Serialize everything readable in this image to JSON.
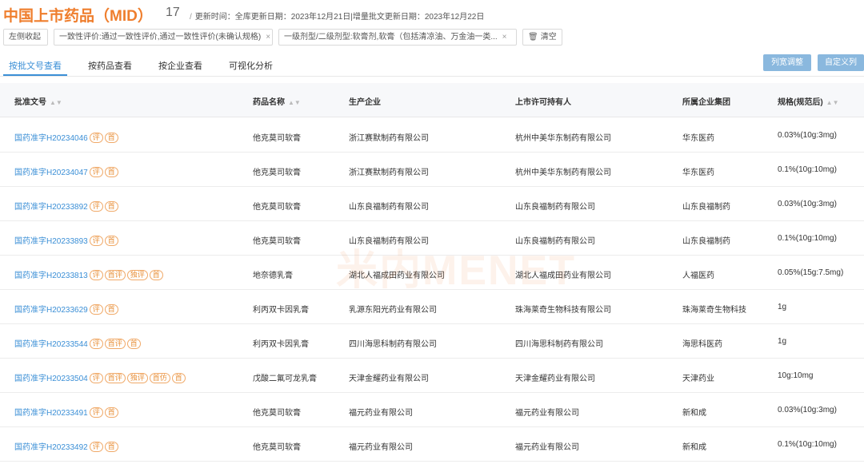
{
  "header": {
    "title": "中国上市药品（MID）",
    "count": "17",
    "update_sep": "/",
    "update_text": "更新时间：全库更新日期：2023年12月21日|增量批文更新日期：2023年12月22日"
  },
  "filters": {
    "collapse_label": "左侧收起",
    "chip1": "一致性评价:通过一致性评价,通过一致性评价(未确认规格)",
    "chip2": "一级剂型/二级剂型:软膏剂,软膏（包括清凉油、万金油一类...",
    "close_glyph": "×",
    "trash_glyph": "🗑",
    "clear_label": "清空"
  },
  "tabs": [
    {
      "label": "按批文号查看",
      "active": true
    },
    {
      "label": "按药品查看",
      "active": false
    },
    {
      "label": "按企业查看",
      "active": false
    },
    {
      "label": "可视化分析",
      "active": false
    }
  ],
  "buttons": {
    "adjust_width": "列宽调整",
    "custom_columns": "自定义列"
  },
  "table": {
    "columns": [
      "批准文号",
      "药品名称",
      "生产企业",
      "上市许可持有人",
      "所属企业集团",
      "规格(规范后)"
    ],
    "sort_glyph": "▲▼",
    "rows": [
      {
        "approval": "国药准字H20234046",
        "tags": [
          "评",
          "首"
        ],
        "drug": "他克莫司软膏",
        "manufacturer": "浙江赛默制药有限公司",
        "holder": "杭州中美华东制药有限公司",
        "group": "华东医药",
        "spec": "0.03%(10g:3mg)"
      },
      {
        "approval": "国药准字H20234047",
        "tags": [
          "评",
          "首"
        ],
        "drug": "他克莫司软膏",
        "manufacturer": "浙江赛默制药有限公司",
        "holder": "杭州中美华东制药有限公司",
        "group": "华东医药",
        "spec": "0.1%(10g:10mg)"
      },
      {
        "approval": "国药准字H20233892",
        "tags": [
          "评",
          "首"
        ],
        "drug": "他克莫司软膏",
        "manufacturer": "山东良福制药有限公司",
        "holder": "山东良福制药有限公司",
        "group": "山东良福制药",
        "spec": "0.03%(10g:3mg)"
      },
      {
        "approval": "国药准字H20233893",
        "tags": [
          "评",
          "首"
        ],
        "drug": "他克莫司软膏",
        "manufacturer": "山东良福制药有限公司",
        "holder": "山东良福制药有限公司",
        "group": "山东良福制药",
        "spec": "0.1%(10g:10mg)"
      },
      {
        "approval": "国药准字H20233813",
        "tags": [
          "评",
          "首评",
          "独评",
          "首"
        ],
        "drug": "地奈德乳膏",
        "manufacturer": "湖北人福成田药业有限公司",
        "holder": "湖北人福成田药业有限公司",
        "group": "人福医药",
        "spec": "0.05%(15g:7.5mg)"
      },
      {
        "approval": "国药准字H20233629",
        "tags": [
          "评",
          "首"
        ],
        "drug": "利丙双卡因乳膏",
        "manufacturer": "乳源东阳光药业有限公司",
        "holder": "珠海莱奇生物科技有限公司",
        "group": "珠海莱奇生物科技",
        "spec": "1g"
      },
      {
        "approval": "国药准字H20233544",
        "tags": [
          "评",
          "首评",
          "首"
        ],
        "drug": "利丙双卡因乳膏",
        "manufacturer": "四川海思科制药有限公司",
        "holder": "四川海思科制药有限公司",
        "group": "海思科医药",
        "spec": "1g"
      },
      {
        "approval": "国药准字H20233504",
        "tags": [
          "评",
          "首评",
          "独评",
          "首仿",
          "首"
        ],
        "drug": "戊酸二氟可龙乳膏",
        "manufacturer": "天津金耀药业有限公司",
        "holder": "天津金耀药业有限公司",
        "group": "天津药业",
        "spec": "10g:10mg"
      },
      {
        "approval": "国药准字H20233491",
        "tags": [
          "评",
          "首"
        ],
        "drug": "他克莫司软膏",
        "manufacturer": "福元药业有限公司",
        "holder": "福元药业有限公司",
        "group": "新和成",
        "spec": "0.03%(10g:3mg)"
      },
      {
        "approval": "国药准字H20233492",
        "tags": [
          "评",
          "首"
        ],
        "drug": "他克莫司软膏",
        "manufacturer": "福元药业有限公司",
        "holder": "福元药业有限公司",
        "group": "新和成",
        "spec": "0.1%(10g:10mg)"
      }
    ]
  },
  "watermark": "米内MENET",
  "colors": {
    "accent": "#3b8fd6",
    "brand": "#ef7e2d",
    "tag": "#e8903a"
  }
}
